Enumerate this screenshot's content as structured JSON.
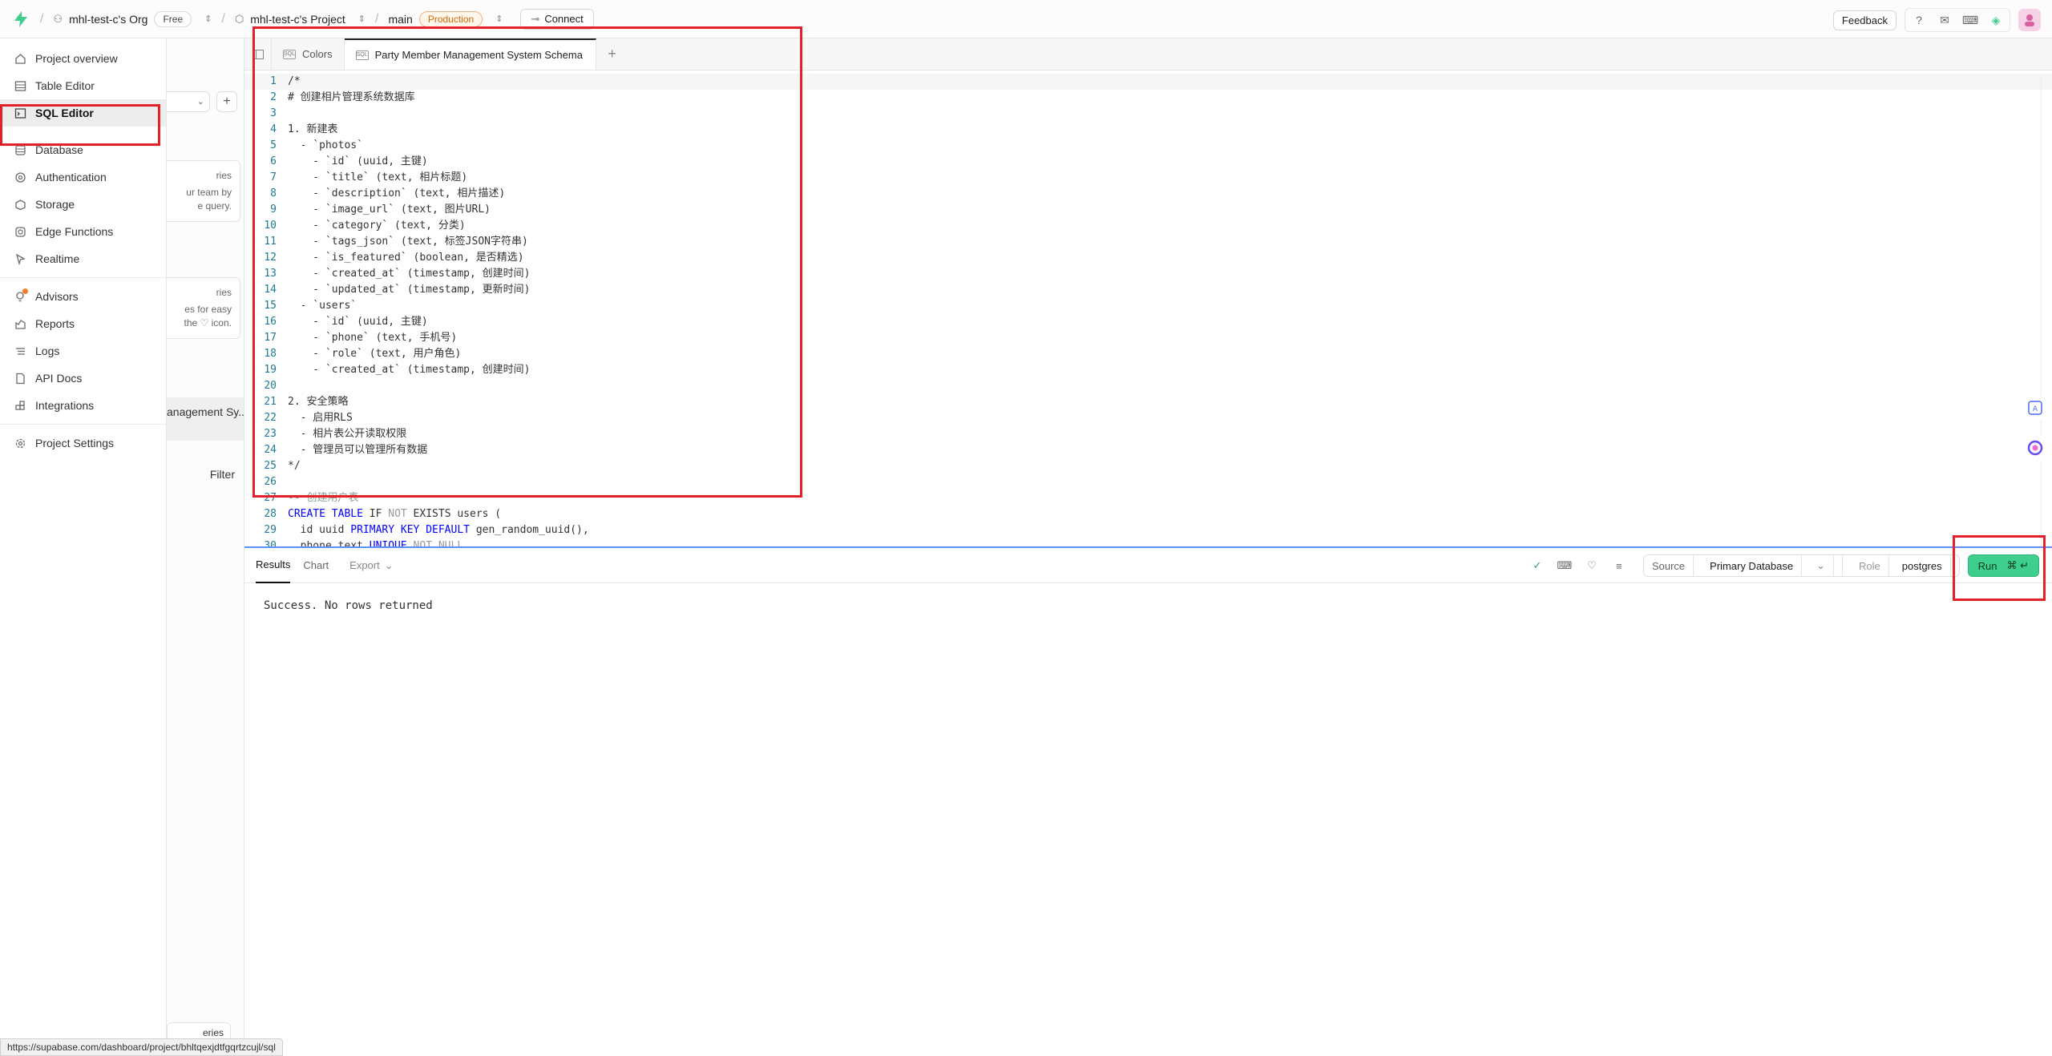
{
  "topbar": {
    "org_name": "mhl-test-c's Org",
    "org_plan": "Free",
    "project_name": "mhl-test-c's Project",
    "branch_name": "main",
    "branch_env": "Production",
    "connect_label": "Connect",
    "feedback_label": "Feedback"
  },
  "nav": {
    "items": [
      {
        "label": "Project overview",
        "icon": "home-icon"
      },
      {
        "label": "Table Editor",
        "icon": "table-icon"
      },
      {
        "label": "SQL Editor",
        "icon": "terminal-icon"
      },
      {
        "label": "Database",
        "icon": "database-icon"
      },
      {
        "label": "Authentication",
        "icon": "users-icon"
      },
      {
        "label": "Storage",
        "icon": "archive-icon"
      },
      {
        "label": "Edge Functions",
        "icon": "code-icon"
      },
      {
        "label": "Realtime",
        "icon": "cursor-icon"
      },
      {
        "label": "Advisors",
        "icon": "lightbulb-icon"
      },
      {
        "label": "Reports",
        "icon": "chart-icon"
      },
      {
        "label": "Logs",
        "icon": "list-icon"
      },
      {
        "label": "API Docs",
        "icon": "file-icon"
      },
      {
        "label": "Integrations",
        "icon": "blocks-icon"
      },
      {
        "label": "Project Settings",
        "icon": "gear-icon"
      }
    ]
  },
  "subbar": {
    "card1": [
      "ries",
      "ur team by",
      "e query."
    ],
    "card2": [
      "ries",
      "es for easy",
      "the ♡ icon."
    ],
    "active_query": "anagement Sy...",
    "filter_label": "Filter",
    "bottom_label": "eries"
  },
  "tabs": {
    "items": [
      {
        "label": "Colors"
      },
      {
        "label": "Party Member Management System Schema"
      }
    ]
  },
  "editor": {
    "lines": [
      "/*",
      "# 创建相片管理系统数据库",
      "",
      "1. 新建表",
      "  - `photos`",
      "    - `id` (uuid, 主键)",
      "    - `title` (text, 相片标题)",
      "    - `description` (text, 相片描述)",
      "    - `image_url` (text, 图片URL)",
      "    - `category` (text, 分类)",
      "    - `tags_json` (text, 标签JSON字符串)",
      "    - `is_featured` (boolean, 是否精选)",
      "    - `created_at` (timestamp, 创建时间)",
      "    - `updated_at` (timestamp, 更新时间)",
      "  - `users`",
      "    - `id` (uuid, 主键)",
      "    - `phone` (text, 手机号)",
      "    - `role` (text, 用户角色)",
      "    - `created_at` (timestamp, 创建时间)",
      "",
      "2. 安全策略",
      "  - 启用RLS",
      "  - 相片表公开读取权限",
      "  - 管理员可以管理所有数据",
      "*/",
      "",
      "-- 创建用户表",
      "CREATE TABLE IF NOT EXISTS users (",
      "  id uuid PRIMARY KEY DEFAULT gen_random_uuid(),",
      "  phone text UNIQUE NOT NULL,"
    ]
  },
  "results": {
    "tabs": [
      "Results",
      "Chart"
    ],
    "export_label": "Export",
    "source_label": "Source",
    "database_label": "Primary Database",
    "role_label": "Role",
    "role_value": "postgres",
    "run_label": "Run",
    "run_shortcut": "⌘ ↵",
    "message": "Success. No rows returned"
  },
  "status_url": "https://supabase.com/dashboard/project/bhltqexjdtfgqrtzcujl/sql",
  "colors": {
    "brand": "#3ecf8e",
    "annotation": "#e5202a",
    "production": "#d46b08"
  }
}
